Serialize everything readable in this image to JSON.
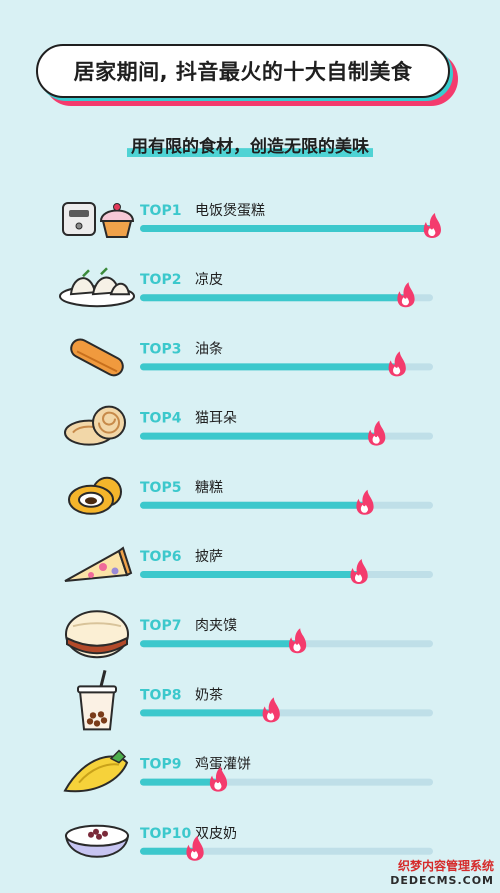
{
  "title": "居家期间, 抖音最火的十大自制美食",
  "subtitle": "用有限的食材，创造无限的美味",
  "colors": {
    "background": "#d9f1f4",
    "bar_track": "#bfdfe8",
    "bar_fill": "#3cc8cc",
    "rank_text": "#3cc8cc",
    "flame": "#f43b6d",
    "title_shadow_teal": "#39cccf",
    "title_shadow_pink": "#f43b6d"
  },
  "chart_data": {
    "type": "bar",
    "orientation": "horizontal",
    "ranks": [
      "TOP1",
      "TOP2",
      "TOP3",
      "TOP4",
      "TOP5",
      "TOP6",
      "TOP7",
      "TOP8",
      "TOP9",
      "TOP10"
    ],
    "categories": [
      "电饭煲蛋糕",
      "凉皮",
      "油条",
      "猫耳朵",
      "糖糕",
      "披萨",
      "肉夹馍",
      "奶茶",
      "鸡蛋灌饼",
      "双皮奶"
    ],
    "values": [
      100,
      91,
      88,
      81,
      77,
      75,
      54,
      45,
      27,
      19
    ],
    "xlim": [
      0,
      100
    ],
    "icons": [
      "rice-cooker-cupcake-icon",
      "liangpi-icon",
      "youtiao-icon",
      "maoerduo-icon",
      "tanggao-icon",
      "pizza-icon",
      "roujiamo-icon",
      "milk-tea-icon",
      "egg-pancake-icon",
      "double-skin-milk-icon"
    ],
    "marker_icon": "flame-icon",
    "grid": false,
    "legend": "none"
  },
  "watermark": {
    "line1": "织梦内容管理系统",
    "line2": "DEDECMS.COM"
  }
}
